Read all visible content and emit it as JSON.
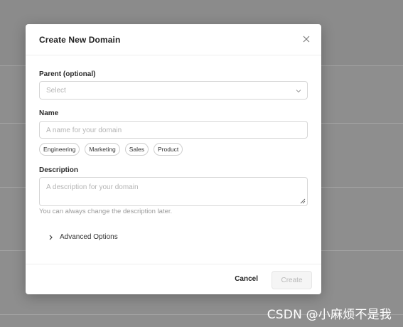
{
  "dialog": {
    "title": "Create New Domain",
    "parent": {
      "label": "Parent (optional)",
      "placeholder": "Select"
    },
    "name": {
      "label": "Name",
      "placeholder": "A name for your domain",
      "suggestions": [
        "Engineering",
        "Marketing",
        "Sales",
        "Product"
      ]
    },
    "description": {
      "label": "Description",
      "placeholder": "A description for your domain",
      "helper": "You can always change the description later."
    },
    "advanced_label": "Advanced Options",
    "footer": {
      "cancel_label": "Cancel",
      "create_label": "Create"
    }
  },
  "watermark": "CSDN @小麻烦不是我",
  "colors": {
    "overlay": "#8e8e8e",
    "disabled_button_bg": "#f5f5f5",
    "border": "#d6d6d6"
  }
}
